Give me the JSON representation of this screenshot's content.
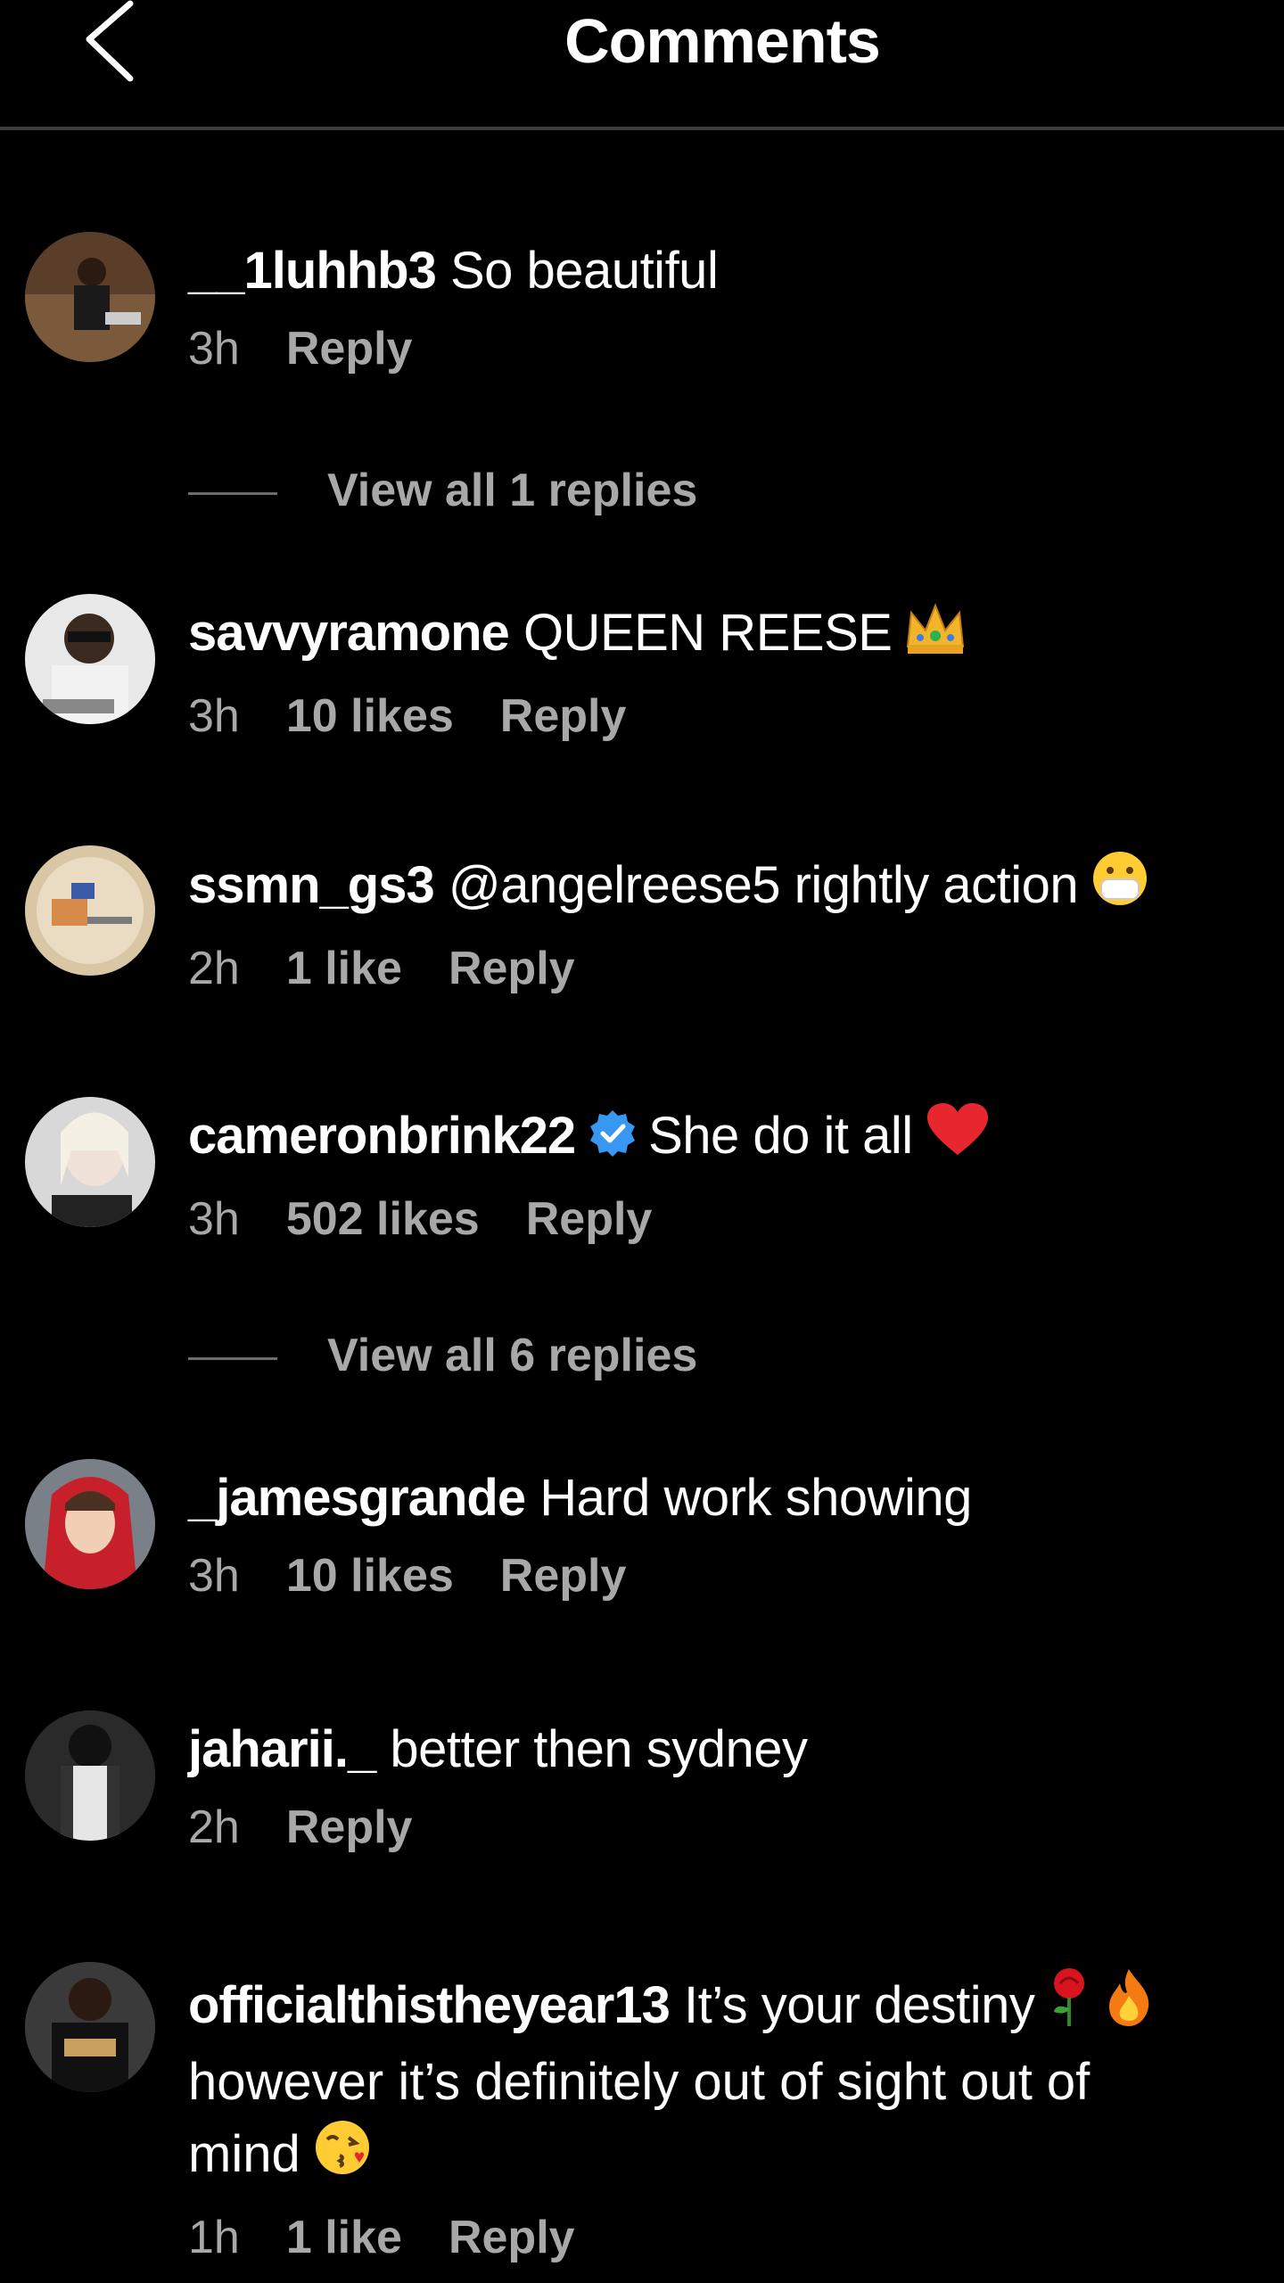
{
  "header": {
    "title": "Comments"
  },
  "comments": [
    {
      "username": "__1luhhb3",
      "text": "So beautiful",
      "time": "3h",
      "likes": "",
      "reply": "Reply",
      "view_replies": "View all 1 replies",
      "emoji": ""
    },
    {
      "username": "savvyramone",
      "text": "QUEEN REESE",
      "time": "3h",
      "likes": "10 likes",
      "reply": "Reply",
      "view_replies": "",
      "emoji": "crown-emoji"
    },
    {
      "username": "ssmn_gs3",
      "text": "@angelreese5 rightly action",
      "time": "2h",
      "likes": "1 like",
      "reply": "Reply",
      "view_replies": "",
      "emoji": "mask-face-emoji"
    },
    {
      "username": "cameronbrink22",
      "text": "She do it all",
      "time": "3h",
      "likes": "502 likes",
      "reply": "Reply",
      "view_replies": "View all 6 replies",
      "verified": true,
      "emoji": "red-heart-emoji"
    },
    {
      "username": "_jamesgrande",
      "text": "Hard work showing",
      "time": "3h",
      "likes": "10 likes",
      "reply": "Reply",
      "view_replies": "",
      "emoji": ""
    },
    {
      "username": "jaharii._",
      "text": "better then sydney",
      "time": "2h",
      "likes": "",
      "reply": "Reply",
      "view_replies": "",
      "emoji": ""
    },
    {
      "username": "officialthistheyear13",
      "text": "It’s your destiny",
      "text_2": "however it’s definitely out of sight out of",
      "text_3": "mind",
      "time": "1h",
      "likes": "1 like",
      "reply": "Reply",
      "view_replies": "",
      "emoji": "rose-fire-kiss-emoji"
    }
  ],
  "colors": {
    "background": "#000000",
    "text": "#ffffff",
    "secondary": "#a8a8a8",
    "verified": "#3897f0",
    "divider": "#3c3c3c"
  }
}
